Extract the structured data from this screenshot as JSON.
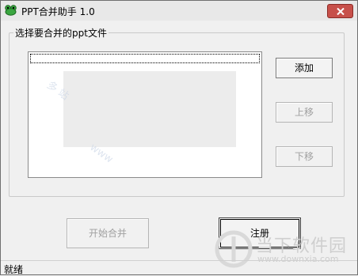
{
  "window": {
    "title": "PPT合并助手 1.0"
  },
  "group": {
    "label": "选择要合并的ppt文件"
  },
  "buttons": {
    "add": "添加",
    "up": "上移",
    "down": "下移",
    "start": "开始合并",
    "register": "注册"
  },
  "statusbar": {
    "text": "就绪"
  },
  "watermark": {
    "title": "当下软件园",
    "url": "www.downxia.com",
    "diag_a": "多 站",
    "diag_b": "www"
  },
  "colors": {
    "close_button": "#c7504a",
    "app_icon": "#3aa640"
  }
}
